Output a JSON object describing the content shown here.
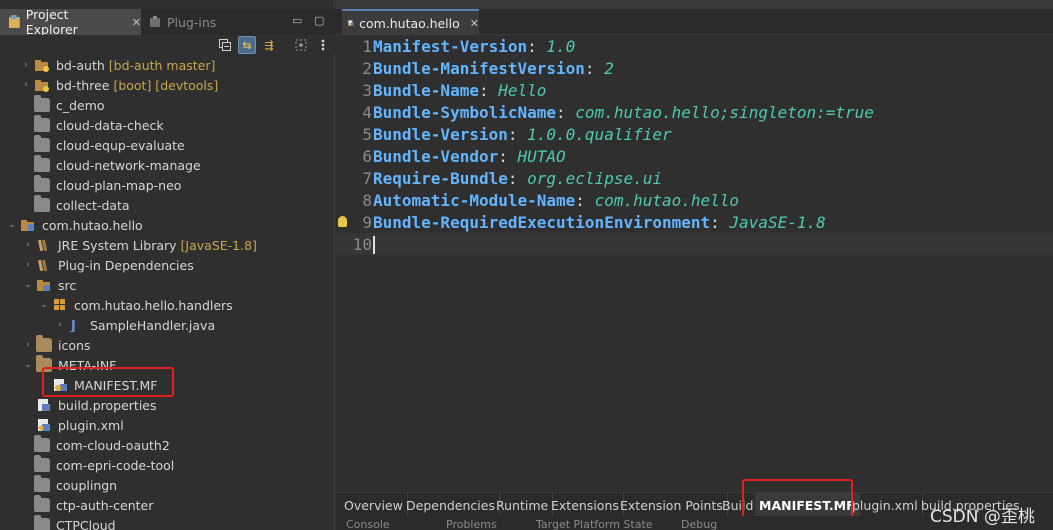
{
  "left_pane": {
    "tabs": [
      {
        "label": "Project Explorer",
        "close": "✕"
      },
      {
        "label": "Plug-ins"
      }
    ],
    "controls": {
      "minimize": "▭",
      "maximize": "▢"
    }
  },
  "tree": [
    {
      "label": "bd-auth",
      "deco": "[bd-auth master]",
      "icon": "project-git-icon",
      "arrow": "›"
    },
    {
      "label": "bd-three",
      "deco": "[boot] [devtools]",
      "icon": "project-git-icon",
      "arrow": "›"
    },
    {
      "label": "c_demo",
      "icon": "folder-icon",
      "arrow": ""
    },
    {
      "label": "cloud-data-check",
      "icon": "folder-icon",
      "arrow": ""
    },
    {
      "label": "cloud-equp-evaluate",
      "icon": "folder-icon",
      "arrow": ""
    },
    {
      "label": "cloud-network-manage",
      "icon": "folder-icon",
      "arrow": ""
    },
    {
      "label": "cloud-plan-map-neo",
      "icon": "folder-icon",
      "arrow": ""
    },
    {
      "label": "collect-data",
      "icon": "folder-icon",
      "arrow": ""
    },
    {
      "label": "com.hutao.hello",
      "icon": "plugin-project-icon",
      "arrow": "⌄"
    },
    {
      "label": "JRE System Library",
      "deco": "[JavaSE-1.8]",
      "icon": "library-icon",
      "arrow": "›"
    },
    {
      "label": "Plug-in Dependencies",
      "icon": "library-icon",
      "arrow": "›"
    },
    {
      "label": "src",
      "icon": "source-folder-icon",
      "arrow": "⌄"
    },
    {
      "label": "com.hutao.hello.handlers",
      "icon": "package-icon",
      "arrow": "⌄"
    },
    {
      "label": "SampleHandler.java",
      "icon": "java-file-icon",
      "arrow": "›"
    },
    {
      "label": "icons",
      "icon": "folder-icon",
      "arrow": "›"
    },
    {
      "label": "META-INF",
      "icon": "folder-icon",
      "arrow": "⌄"
    },
    {
      "label": "MANIFEST.MF",
      "icon": "manifest-file-icon",
      "arrow": ""
    },
    {
      "label": "build.properties",
      "icon": "properties-file-icon",
      "arrow": ""
    },
    {
      "label": "plugin.xml",
      "icon": "xml-file-icon",
      "arrow": ""
    },
    {
      "label": "com-cloud-oauth2",
      "icon": "folder-icon",
      "arrow": ""
    },
    {
      "label": "com-epri-code-tool",
      "icon": "folder-icon",
      "arrow": ""
    },
    {
      "label": "couplingn",
      "icon": "folder-icon",
      "arrow": ""
    },
    {
      "label": "ctp-auth-center",
      "icon": "folder-icon",
      "arrow": ""
    },
    {
      "label": "CTPCloud",
      "icon": "folder-icon",
      "arrow": ""
    }
  ],
  "editor": {
    "tab_label": "com.hutao.hello",
    "tab_close": "✕",
    "lines": [
      {
        "num": "1",
        "key": "Manifest-Version",
        "sep": ": ",
        "val": "1.0"
      },
      {
        "num": "2",
        "key": "Bundle-ManifestVersion",
        "sep": ": ",
        "val": "2"
      },
      {
        "num": "3",
        "key": "Bundle-Name",
        "sep": ": ",
        "val": "Hello"
      },
      {
        "num": "4",
        "key": "Bundle-SymbolicName",
        "sep": ": ",
        "val": "com.hutao.hello;singleton:=true"
      },
      {
        "num": "5",
        "key": "Bundle-Version",
        "sep": ": ",
        "val": "1.0.0.qualifier"
      },
      {
        "num": "6",
        "key": "Bundle-Vendor",
        "sep": ": ",
        "val": "HUTAO"
      },
      {
        "num": "7",
        "key": "Require-Bundle",
        "sep": ": ",
        "val": "org.eclipse.ui"
      },
      {
        "num": "8",
        "key": "Automatic-Module-Name",
        "sep": ": ",
        "val": "com.hutao.hello"
      },
      {
        "num": "9",
        "key": "Bundle-RequiredExecutionEnvironment",
        "sep": ": ",
        "val": "JavaSE-1.8"
      },
      {
        "num": "10",
        "key": "",
        "sep": "",
        "val": ""
      }
    ],
    "bottom_tabs": [
      "Overview",
      "Dependencies",
      "Runtime",
      "Extensions",
      "Extension Points",
      "Build",
      "MANIFEST.MF",
      "plugin.xml",
      "build.properties"
    ],
    "active_bottom_tab": "MANIFEST.MF"
  },
  "bottom_strip": [
    "Console",
    "Problems",
    "Target Platform State",
    "Debug"
  ],
  "watermark": "CSDN @歪桃",
  "colors": {
    "highlight_box": "#e0201f",
    "key": "#63b5ff",
    "value": "#4ec9b0"
  }
}
